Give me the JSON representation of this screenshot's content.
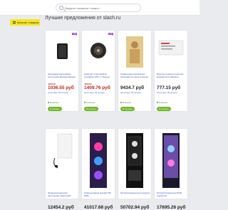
{
  "search": {
    "placeholder": "Введите название товара..."
  },
  "catalog_label": "Каталог товаров",
  "page_title": "Лучшие предложения от slach.ru",
  "cards": [
    {
      "badge": "-5%",
      "title": "Накладная раскладная постельная фрезерованная",
      "store": "JSPGЖ",
      "price": "1036.55 руб",
      "shop": "д/наз кадр. 89 продаж",
      "avail": "В наличии",
      "button": "В корзину",
      "price_color": "#c8201b"
    },
    {
      "badge": "-5%",
      "title": "Комплект пластиковой трехфазы 125 ст плотные",
      "store": "JSPGЖ",
      "price": "1409.76 руб",
      "shop": "д/наз кадр. 89 продаж",
      "avail": "В наличии",
      "button": "В корзину",
      "price_color": "#c8201b"
    },
    {
      "badge": "",
      "title": "Подарочная композиция Королева на троне в короне",
      "store": "",
      "price": "9434.7 руб",
      "shop": "д/наз кадр. 89 продаж",
      "avail": "В наличии",
      "button": "В корзину",
      "price_color": "#222222"
    },
    {
      "badge": "",
      "title": "Визитка 4 цвета в наличии выводится в шаблоне",
      "store": "",
      "price": "777.15 руб",
      "shop": "д/наз кадр. 89 продаж",
      "avail": "В наличии",
      "button": "В корзину",
      "price_color": "#222222"
    },
    {
      "badge": "",
      "title": "Профессиональная настольная лампа LED",
      "store": "",
      "price": "12454.2 руб",
      "shop": "д/наз кадр. 89 продаж",
      "avail": "",
      "button": "",
      "price_color": "#222222"
    },
    {
      "badge": "",
      "title": "Компьютерный игровой ПК RGB",
      "store": "",
      "price": "41017.68 руб",
      "shop": "д/наз кадр. 89 продаж",
      "avail": "",
      "button": "",
      "price_color": "#222222"
    },
    {
      "badge": "",
      "title": "Игровой компьютер в корпусе",
      "store": "",
      "price": "50702.94 руб",
      "shop": "д/наз кадр. 89 продаж",
      "avail": "",
      "button": "",
      "price_color": "#222222"
    },
    {
      "badge": "",
      "title": "Игровой компьютер RGB подсветка",
      "store": "",
      "price": "17695.26 руб",
      "shop": "д/наз кадр. 89 продаж",
      "avail": "",
      "button": "",
      "price_color": "#222222"
    }
  ]
}
